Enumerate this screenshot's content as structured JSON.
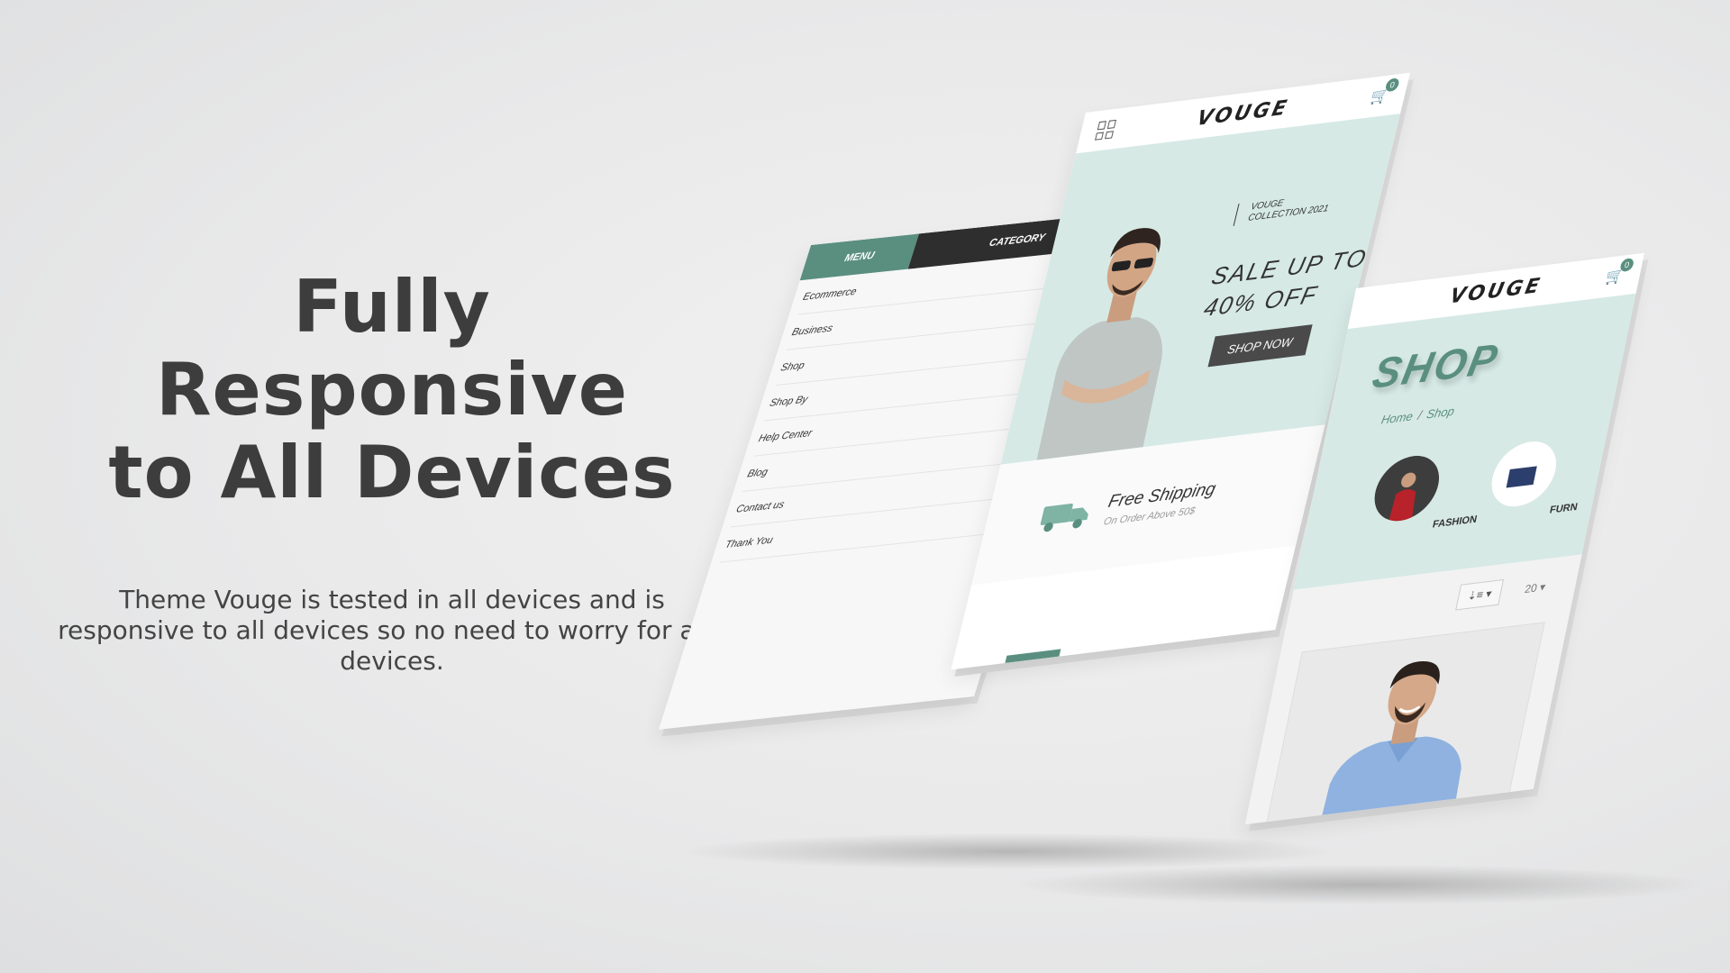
{
  "hero": {
    "title_line1": "Fully Responsive",
    "title_line2": "to All Devices",
    "description": "Theme Vouge is tested in all devices and is responsive to all devices so no need to worry for any devices."
  },
  "colors": {
    "accent": "#5a8f7f",
    "hero_bg": "#d6e9e5",
    "dark": "#2e2e2e"
  },
  "menu_screen": {
    "tabs": [
      "MENU",
      "CATEGORY"
    ],
    "items": [
      {
        "label": "Ecommerce",
        "has_submenu": true
      },
      {
        "label": "Business",
        "has_submenu": true
      },
      {
        "label": "Shop",
        "has_submenu": false
      },
      {
        "label": "Shop By",
        "has_submenu": true
      },
      {
        "label": "Help Center",
        "has_submenu": false
      },
      {
        "label": "Blog",
        "has_submenu": false
      },
      {
        "label": "Contact us",
        "has_submenu": false
      },
      {
        "label": "Thank You",
        "has_submenu": false
      }
    ],
    "chevron": "›"
  },
  "home_screen": {
    "logo": "VOUGE",
    "cart_count": "0",
    "collection_line1": "VOUGE",
    "collection_line2": "COLLECTION 2021",
    "sale_line1": "SALE UP TO",
    "sale_line2": "40% OFF",
    "cta": "SHOP NOW",
    "shipping_title": "Free Shipping",
    "shipping_sub": "On Order Above 50$",
    "icons": [
      "grid-icon",
      "cart-icon",
      "truck-icon"
    ]
  },
  "shop_screen": {
    "logo": "VOUGE",
    "cart_count": "0",
    "title": "SHOP",
    "breadcrumb": [
      "Home",
      "Shop"
    ],
    "breadcrumb_sep": "/",
    "categories": [
      "FASHION",
      "FURN"
    ],
    "sort_icon": "⇣≡ ▾",
    "per_page": "20 ▾"
  }
}
